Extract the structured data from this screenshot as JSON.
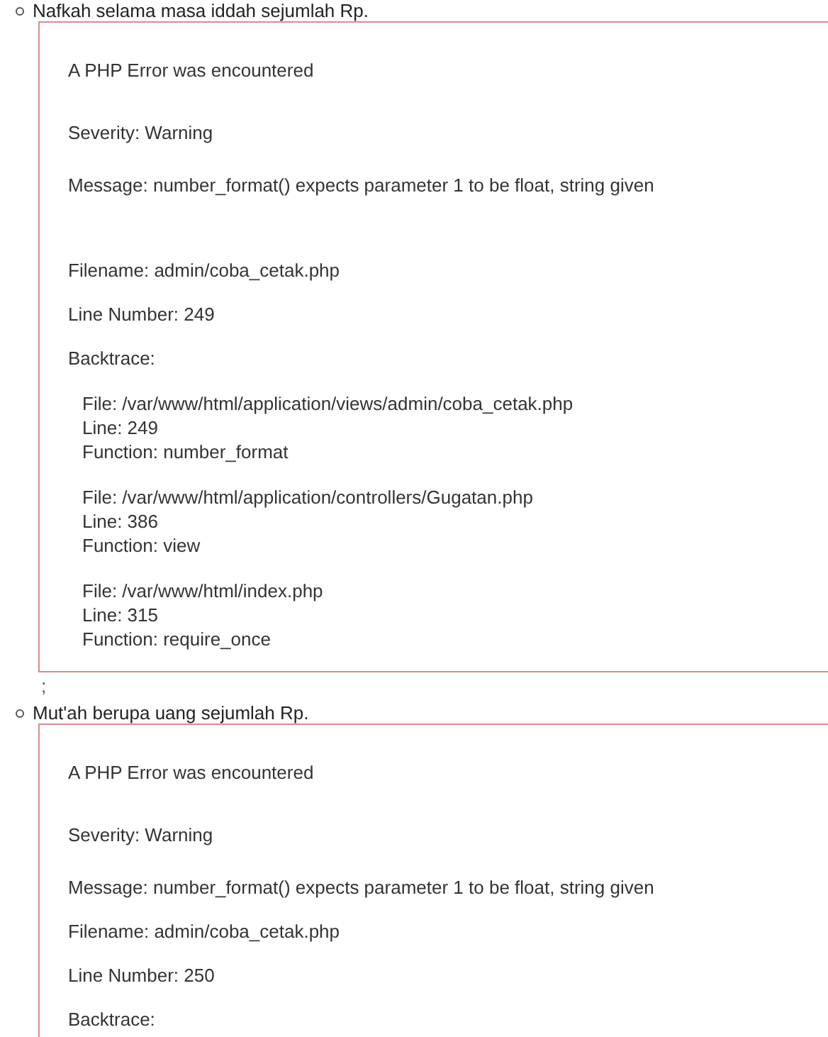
{
  "items": [
    {
      "label": "Nafkah selama masa iddah sejumlah Rp.",
      "error": {
        "heading": "A PHP Error was encountered",
        "severity": "Severity: Warning",
        "message": "Message: number_format() expects parameter 1 to be float, string given",
        "filename": "Filename: admin/coba_cetak.php",
        "line_number": "Line Number: 249",
        "backtrace_label": "Backtrace:",
        "backtrace": [
          {
            "file": "File: /var/www/html/application/views/admin/coba_cetak.php",
            "line": "Line: 249",
            "function": "Function: number_format"
          },
          {
            "file": "File: /var/www/html/application/controllers/Gugatan.php",
            "line": "Line: 386",
            "function": "Function: view"
          },
          {
            "file": "File: /var/www/html/index.php",
            "line": "Line: 315",
            "function": "Function: require_once"
          }
        ]
      },
      "after": ";"
    },
    {
      "label": "Mut'ah berupa uang sejumlah Rp.",
      "error": {
        "heading": "A PHP Error was encountered",
        "severity": "Severity: Warning",
        "message": "Message: number_format() expects parameter 1 to be float, string given",
        "filename": "Filename: admin/coba_cetak.php",
        "line_number": "Line Number: 250",
        "backtrace_label": "Backtrace:"
      }
    }
  ]
}
